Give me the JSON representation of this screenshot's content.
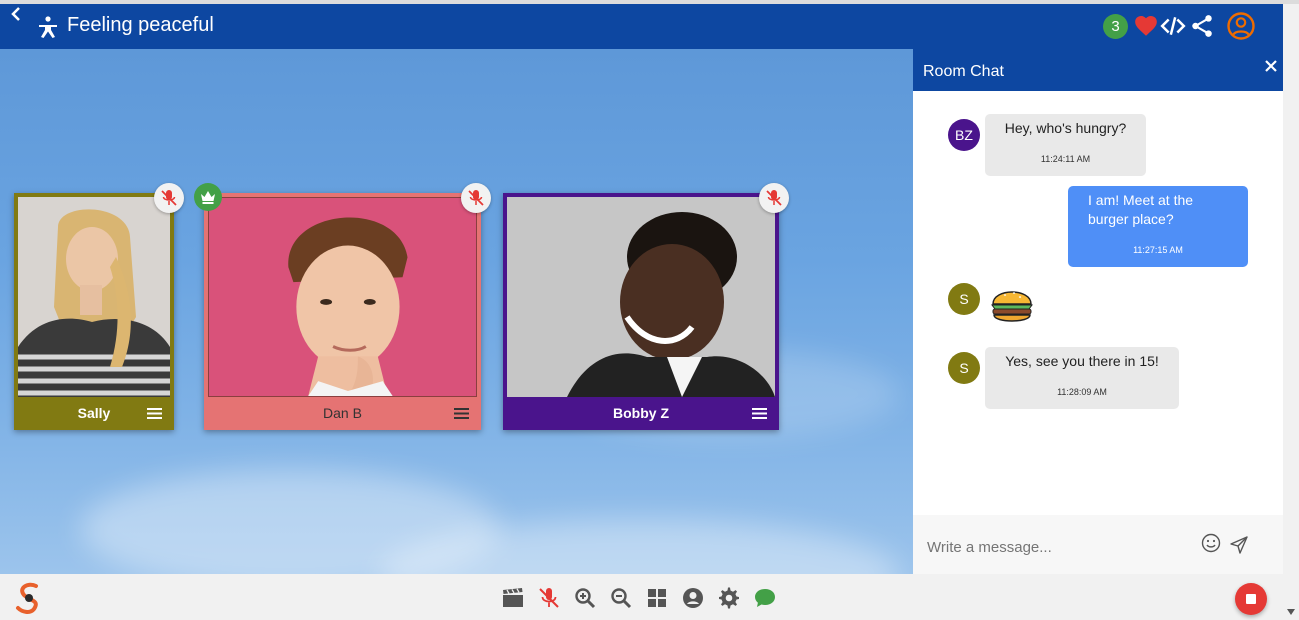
{
  "header": {
    "title": "Feeling peaceful",
    "notification_count": "3",
    "icons": [
      "back-arrow-icon",
      "person-meditation-icon",
      "heart-icon",
      "code-icon",
      "share-icon",
      "account-circle-icon"
    ]
  },
  "participants": [
    {
      "name": "Sally",
      "color": "#817a12",
      "muted": true
    },
    {
      "name": "Dan B",
      "color": "#e57373",
      "muted": true,
      "host": true
    },
    {
      "name": "Bobby Z",
      "color": "#4a148c",
      "muted": true
    }
  ],
  "chat": {
    "title": "Room Chat",
    "messages": [
      {
        "avatar": "BZ",
        "avatar_color": "#4a148c",
        "text": "Hey, who's hungry?",
        "time": "11:24:11 AM",
        "own": false
      },
      {
        "text_line1": "I am! Meet at the",
        "text_line2": "burger place?",
        "time": "11:27:15 AM",
        "own": true
      },
      {
        "avatar": "S",
        "avatar_color": "#817a12",
        "emoji": "hamburger",
        "own": false
      },
      {
        "avatar": "S",
        "avatar_color": "#817a12",
        "text": "Yes, see you there in 15!",
        "time": "11:28:09 AM",
        "own": false
      }
    ],
    "input_placeholder": "Write a message..."
  },
  "colors": {
    "header_blue": "#0d47a1",
    "own_bubble": "#4f8ff7",
    "other_bubble": "#e9e9e9",
    "stop_red": "#e53935",
    "chat_green": "#43a047"
  },
  "toolbar": {
    "icons": [
      "clapperboard-icon",
      "mic-off-icon",
      "zoom-in-icon",
      "zoom-out-icon",
      "grid-view-icon",
      "account-icon",
      "settings-icon",
      "chat-icon",
      "stop-button"
    ]
  }
}
